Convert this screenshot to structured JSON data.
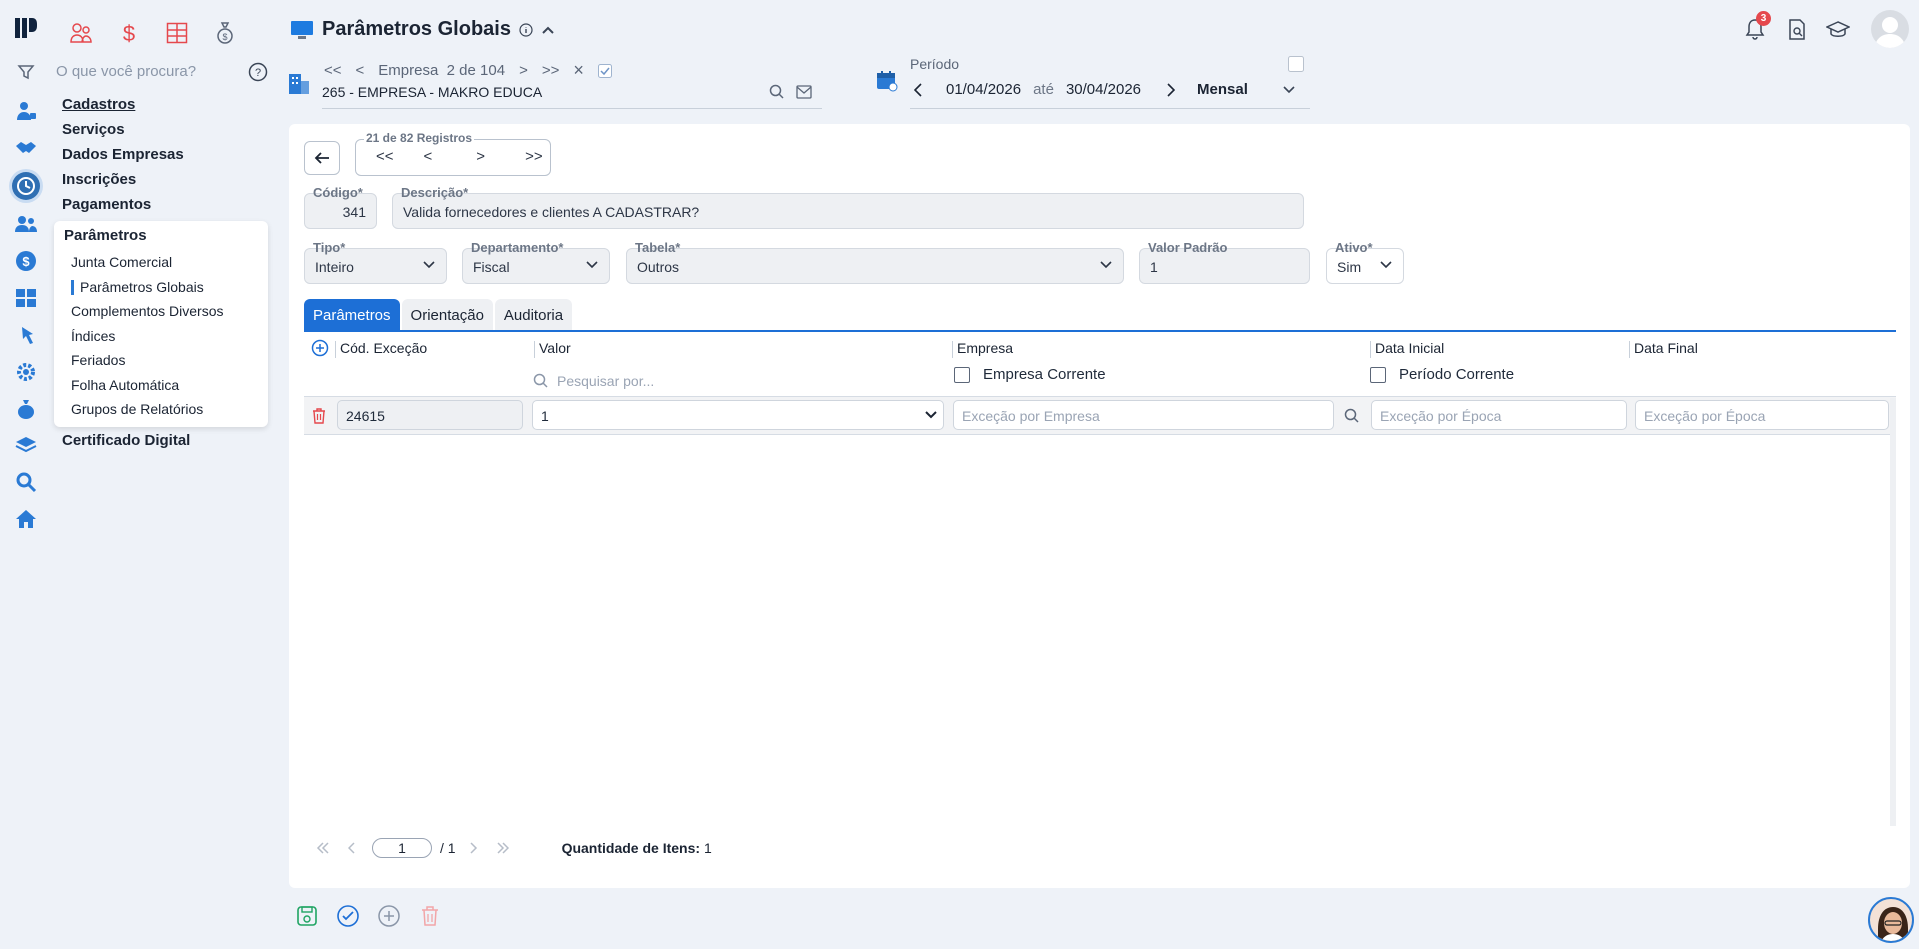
{
  "search": {
    "placeholder": "O que você procura?"
  },
  "menu": {
    "top_items": [
      "Cadastros",
      "Serviços",
      "Dados Empresas",
      "Inscrições",
      "Pagamentos"
    ],
    "submenu_title": "Parâmetros",
    "submenu_items": [
      "Junta Comercial",
      "Parâmetros Globais",
      "Complementos Diversos",
      "Índices",
      "Feriados",
      "Folha Automática",
      "Grupos de Relatórios"
    ],
    "bottom_item": "Certificado Digital"
  },
  "header": {
    "title": "Parâmetros Globais",
    "empresa_nav": {
      "first": "<<",
      "prev": "<",
      "label": "Empresa",
      "position": "2 de 104",
      "next": ">",
      "last": ">>",
      "close": "×"
    },
    "empresa_value": "265 - EMPRESA - MAKRO EDUCA",
    "periodo": {
      "label": "Período",
      "start": "01/04/2026",
      "ate": "até",
      "end": "30/04/2026",
      "mode": "Mensal"
    },
    "notifications_count": "3"
  },
  "registro": {
    "legend": "21 de 82 Registros",
    "buttons": [
      "<<",
      "<",
      ">",
      ">>"
    ]
  },
  "form": {
    "codigo": {
      "label": "Código*",
      "value": "341"
    },
    "descricao": {
      "label": "Descrição*",
      "value": "Valida fornecedores e clientes A CADASTRAR?"
    },
    "tipo": {
      "label": "Tipo*",
      "value": "Inteiro"
    },
    "departamento": {
      "label": "Departamento*",
      "value": "Fiscal"
    },
    "tabela": {
      "label": "Tabela*",
      "value": "Outros"
    },
    "valor_padrao": {
      "label": "Valor Padrão",
      "value": "1"
    },
    "ativo": {
      "label": "Ativo*",
      "value": "Sim"
    }
  },
  "tabs": [
    "Parâmetros",
    "Orientação",
    "Auditoria"
  ],
  "grid": {
    "headers": {
      "cod": "Cód. Exceção",
      "valor": "Valor",
      "empresa": "Empresa",
      "data_inicial": "Data Inicial",
      "data_final": "Data Final"
    },
    "valor_search_placeholder": "Pesquisar por...",
    "empresa_corrente": "Empresa Corrente",
    "periodo_corrente": "Período Corrente",
    "rows": [
      {
        "cod": "24615",
        "valor": "1",
        "empresa_placeholder": "Exceção por Empresa",
        "data_inicial_placeholder": "Exceção por Época",
        "data_final_placeholder": "Exceção por Época"
      }
    ]
  },
  "pager": {
    "page": "1",
    "of": "/ 1",
    "qty_label": "Quantidade de Itens:",
    "qty_value": "1"
  },
  "colors": {
    "accent": "#1d6fd6",
    "danger": "#e5484d",
    "success": "#1fa463"
  }
}
